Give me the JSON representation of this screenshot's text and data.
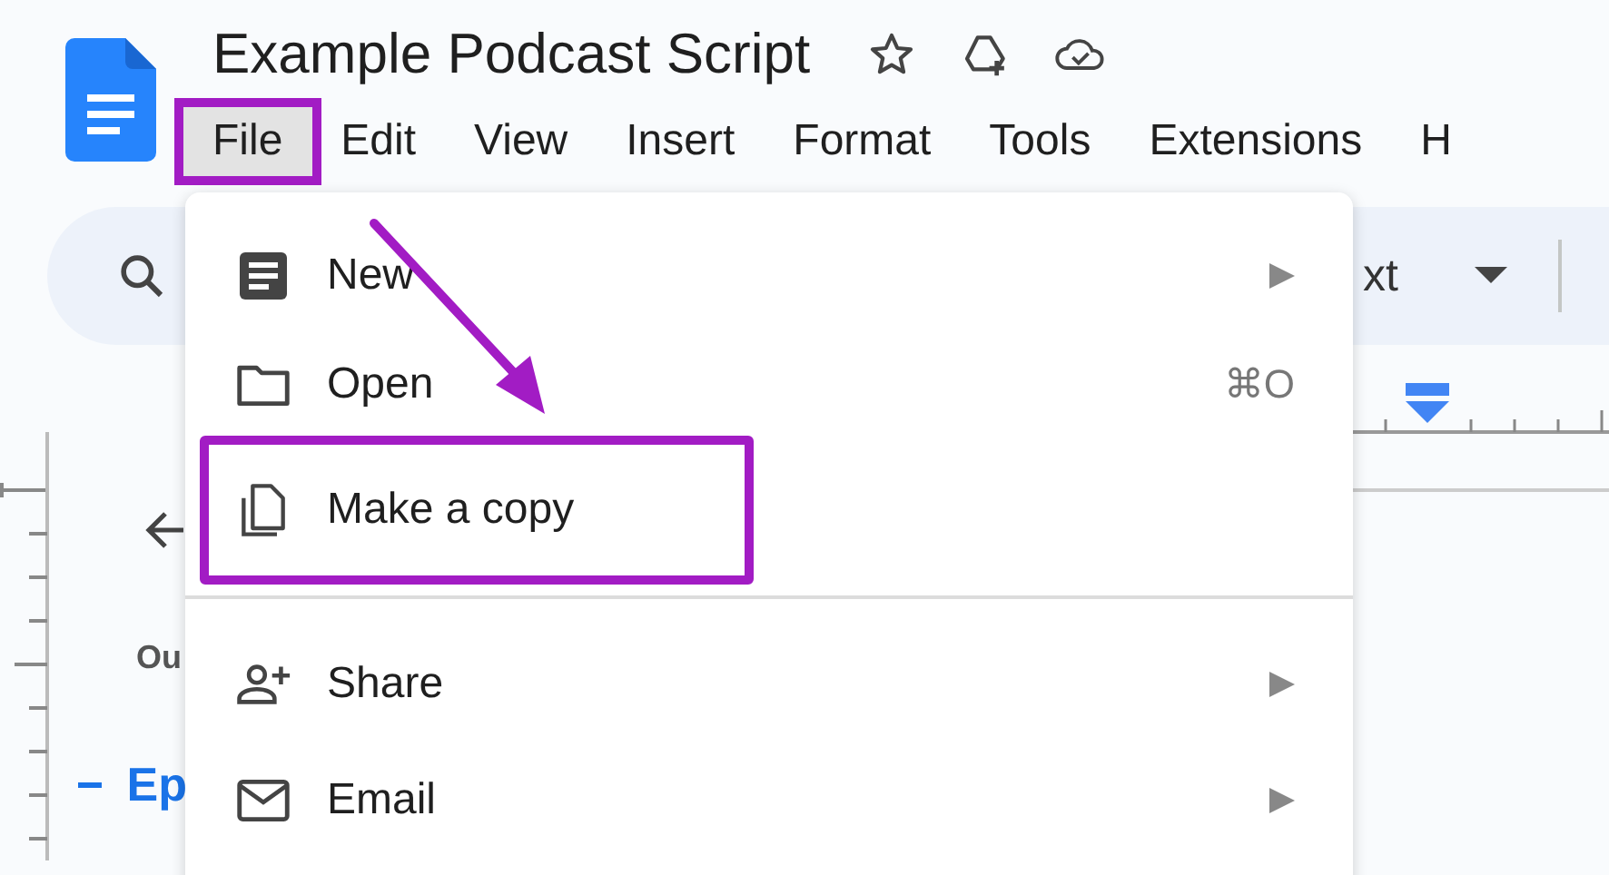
{
  "document": {
    "title": "Example Podcast Script"
  },
  "menu_bar": [
    {
      "label": "File",
      "selected": true,
      "highlighted": true
    },
    {
      "label": "Edit",
      "selected": false,
      "highlighted": false
    },
    {
      "label": "View",
      "selected": false,
      "highlighted": false
    },
    {
      "label": "Insert",
      "selected": false,
      "highlighted": false
    },
    {
      "label": "Format",
      "selected": false,
      "highlighted": false
    },
    {
      "label": "Tools",
      "selected": false,
      "highlighted": false
    },
    {
      "label": "Extensions",
      "selected": false,
      "highlighted": false
    },
    {
      "label": "H",
      "selected": false,
      "highlighted": false
    }
  ],
  "toolbar": {
    "style_text": "xt"
  },
  "outline": {
    "label": "Ou",
    "heading": "Ep"
  },
  "file_menu": {
    "items": [
      {
        "kind": "item",
        "label": "New",
        "submenu": true,
        "highlighted": false
      },
      {
        "kind": "item",
        "label": "Open",
        "shortcut": "⌘O",
        "submenu": false,
        "highlighted": false
      },
      {
        "kind": "item",
        "label": "Make a copy",
        "submenu": false,
        "highlighted": true
      },
      {
        "kind": "separator"
      },
      {
        "kind": "item",
        "label": "Share",
        "submenu": true,
        "highlighted": false
      },
      {
        "kind": "item",
        "label": "Email",
        "submenu": true,
        "highlighted": false
      }
    ]
  }
}
